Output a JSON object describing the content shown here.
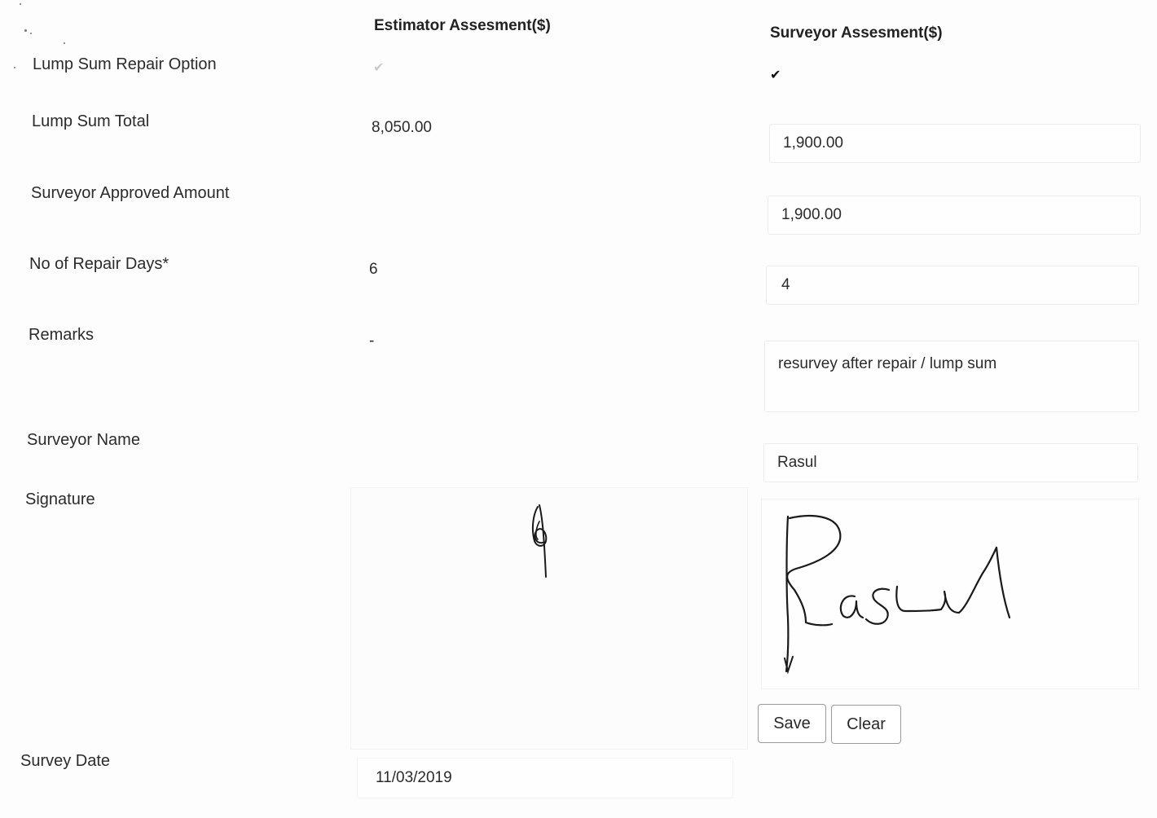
{
  "columns": {
    "estimator_header": "Estimator Assesment($)",
    "surveyor_header": "Surveyor Assesment($)"
  },
  "rows": {
    "lump_sum_repair_option": {
      "label": "Lump Sum Repair Option",
      "estimator_checked": true,
      "surveyor_checked": true
    },
    "lump_sum_total": {
      "label": "Lump Sum Total",
      "estimator": "8,050.00",
      "surveyor": "1,900.00"
    },
    "surveyor_approved_amount": {
      "label": "Surveyor Approved Amount",
      "surveyor": "1,900.00"
    },
    "repair_days": {
      "label": "No of Repair Days*",
      "estimator": "6",
      "surveyor": "4"
    },
    "remarks": {
      "label": "Remarks",
      "estimator": "-",
      "surveyor": "resurvey after repair / lump sum"
    },
    "surveyor_name": {
      "label": "Surveyor Name",
      "surveyor": "Rasul"
    },
    "signature": {
      "label": "Signature"
    },
    "survey_date": {
      "label": "Survey Date",
      "estimator": "11/03/2019"
    }
  },
  "buttons": {
    "save": "Save",
    "clear": "Clear"
  },
  "icons": {
    "checkmark": "check-icon"
  },
  "colors": {
    "checkmark_faded": "#c9c9c9",
    "checkmark_dark": "#111111",
    "ink": "#1a1a1a"
  }
}
